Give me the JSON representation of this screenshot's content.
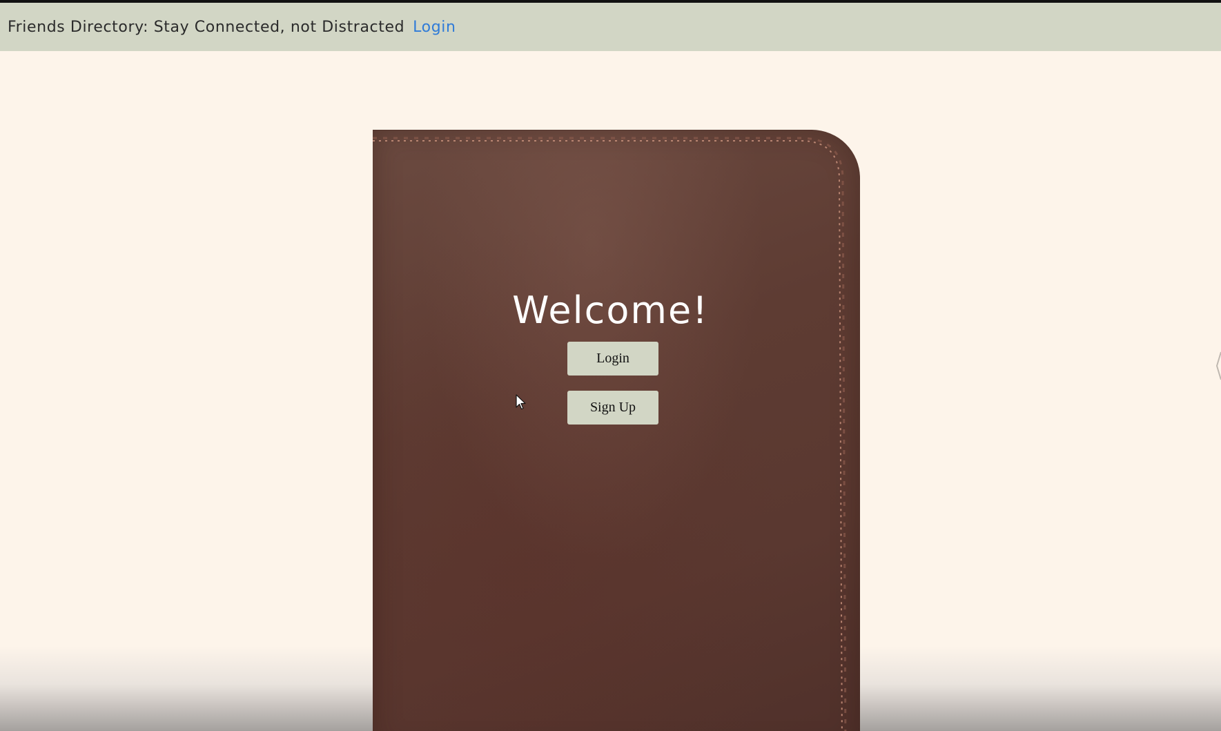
{
  "navbar": {
    "title": "Friends Directory: Stay Connected, not Distracted",
    "login_link": "Login"
  },
  "hero": {
    "heading": "Welcome!",
    "login_button": "Login",
    "signup_button": "Sign Up"
  },
  "colors": {
    "navbar_bg": "#d2d6c5",
    "page_bg": "#fdf4ea",
    "link": "#2f7bd8",
    "leather": "#5e3c33",
    "button_bg": "#d2d6c5"
  }
}
